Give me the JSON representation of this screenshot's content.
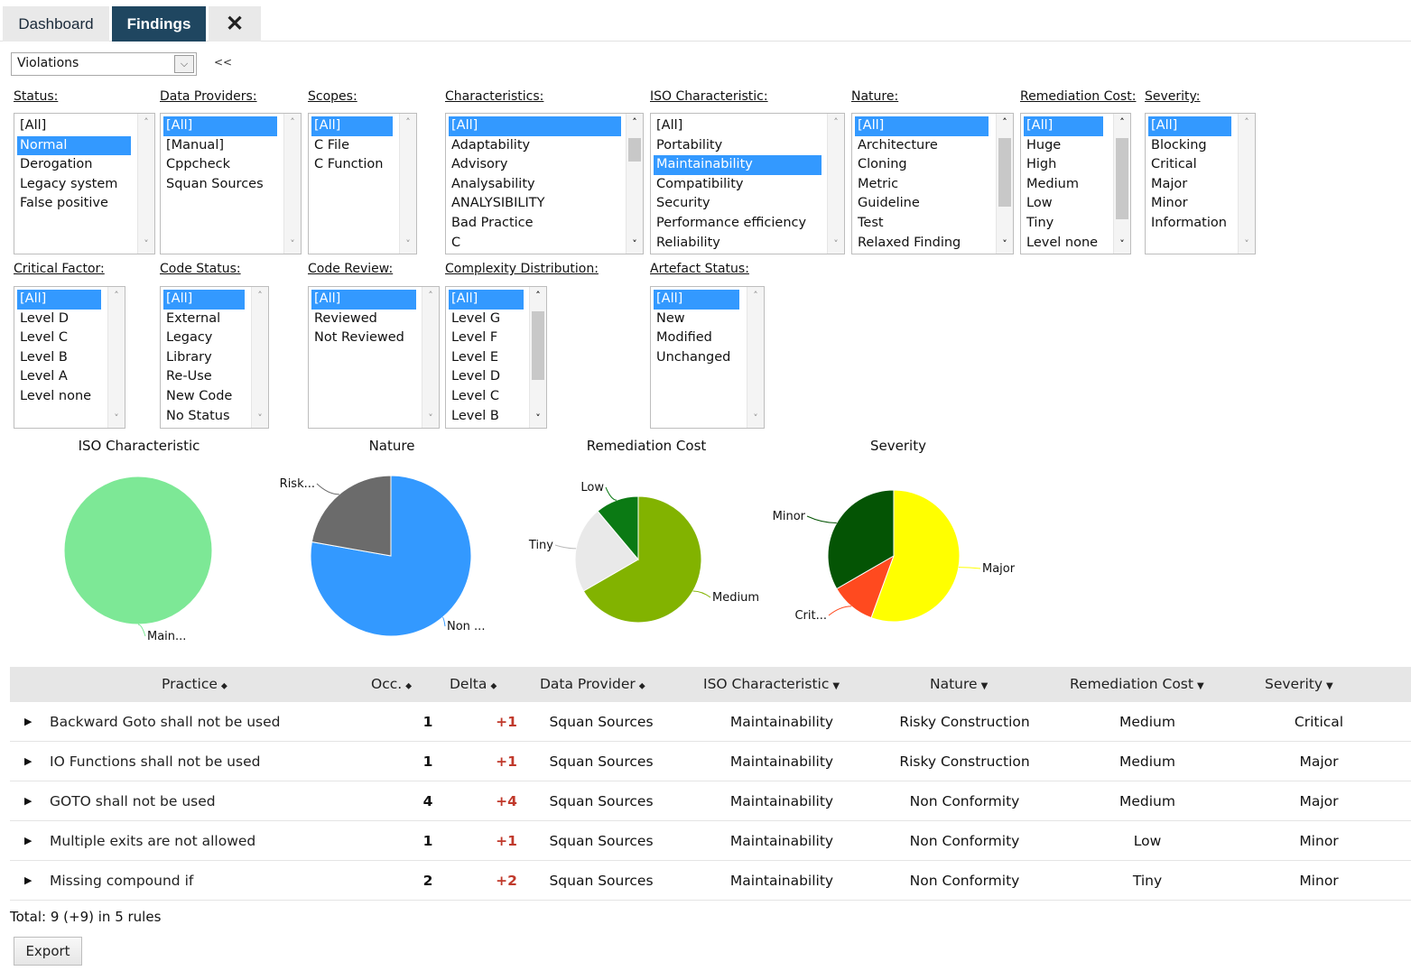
{
  "tabs": {
    "dashboard": "Dashboard",
    "findings": "Findings",
    "tools_icon": "tools-icon",
    "tools_glyph": "✕"
  },
  "view_select": {
    "value": "Violations",
    "collapse": "<<"
  },
  "filters": [
    {
      "label": "Status:",
      "options": [
        "[All]",
        "Normal",
        "Derogation",
        "Legacy system",
        "False positive"
      ],
      "selected": 1
    },
    {
      "label": "Data Providers:",
      "options": [
        "[All]",
        "[Manual]",
        "Cppcheck",
        "Squan Sources"
      ],
      "selected": 0
    },
    {
      "label": "Scopes:",
      "options": [
        "[All]",
        "C File",
        "C Function"
      ],
      "selected": 0
    },
    {
      "label": "Characteristics:",
      "options": [
        "[All]",
        "Adaptability",
        "Advisory",
        "Analysability",
        "ANALYSIBILITY",
        "Bad Practice",
        "C"
      ],
      "selected": 0
    },
    {
      "label": "ISO Characteristic:",
      "options": [
        "[All]",
        "Portability",
        "Maintainability",
        "Compatibility",
        "Security",
        "Performance efficiency",
        "Reliability"
      ],
      "selected": 2
    },
    {
      "label": "Nature:",
      "options": [
        "[All]",
        "Architecture",
        "Cloning",
        "Metric",
        "Guideline",
        "Test",
        "Relaxed Finding"
      ],
      "selected": 0
    },
    {
      "label": "Remediation Cost:",
      "options": [
        "[All]",
        "Huge",
        "High",
        "Medium",
        "Low",
        "Tiny",
        "Level none"
      ],
      "selected": 0
    },
    {
      "label": "Severity:",
      "options": [
        "[All]",
        "Blocking",
        "Critical",
        "Major",
        "Minor",
        "Information"
      ],
      "selected": 0
    },
    {
      "label": "Critical Factor:",
      "options": [
        "[All]",
        "Level D",
        "Level C",
        "Level B",
        "Level A",
        "Level none"
      ],
      "selected": 0
    },
    {
      "label": "Code Status:",
      "options": [
        "[All]",
        "External",
        "Legacy",
        "Library",
        "Re-Use",
        "New Code",
        "No Status"
      ],
      "selected": 0
    },
    {
      "label": "Code Review:",
      "options": [
        "[All]",
        "Reviewed",
        "Not Reviewed"
      ],
      "selected": 0
    },
    {
      "label": "Complexity Distribution:",
      "options": [
        "[All]",
        "Level G",
        "Level F",
        "Level E",
        "Level D",
        "Level C",
        "Level B"
      ],
      "selected": 0
    },
    {
      "label": "Artefact Status:",
      "options": [
        "[All]",
        "New",
        "Modified",
        "Unchanged"
      ],
      "selected": 0
    }
  ],
  "chart_data": [
    {
      "type": "pie",
      "title": "ISO Characteristic",
      "slices": [
        {
          "label": "Main...",
          "value": 9,
          "color": "#7de896"
        }
      ]
    },
    {
      "type": "pie",
      "title": "Nature",
      "slices": [
        {
          "label": "Non ...",
          "value": 7,
          "color": "#3399ff"
        },
        {
          "label": "Risk...",
          "value": 2,
          "color": "#6b6b6b"
        }
      ]
    },
    {
      "type": "pie",
      "title": "Remediation Cost",
      "slices": [
        {
          "label": "Medium",
          "value": 6,
          "color": "#82b300"
        },
        {
          "label": "Tiny",
          "value": 2,
          "color": "#e9e9e9"
        },
        {
          "label": "Low",
          "value": 1,
          "color": "#0b7a14"
        }
      ]
    },
    {
      "type": "pie",
      "title": "Severity",
      "slices": [
        {
          "label": "Major",
          "value": 5,
          "color": "#ffff00"
        },
        {
          "label": "Crit...",
          "value": 1,
          "color": "#ff4a1f"
        },
        {
          "label": "Minor",
          "value": 3,
          "color": "#045404"
        }
      ]
    }
  ],
  "table": {
    "headers": {
      "practice": "Practice",
      "occ": "Occ.",
      "delta": "Delta",
      "dp": "Data Provider",
      "iso": "ISO Characteristic",
      "nat": "Nature",
      "rc": "Remediation Cost",
      "sev": "Severity"
    },
    "sort_asc_glyph": "⬥",
    "sort_desc_glyph": "▼",
    "expander_glyph": "▶",
    "rows": [
      {
        "practice": "Backward Goto shall not be used",
        "occ": "1",
        "delta": "+1",
        "dp": "Squan Sources",
        "iso": "Maintainability",
        "nat": "Risky Construction",
        "rc": "Medium",
        "sev": "Critical"
      },
      {
        "practice": "IO Functions shall not be used",
        "occ": "1",
        "delta": "+1",
        "dp": "Squan Sources",
        "iso": "Maintainability",
        "nat": "Risky Construction",
        "rc": "Medium",
        "sev": "Major"
      },
      {
        "practice": "GOTO shall not be used",
        "occ": "4",
        "delta": "+4",
        "dp": "Squan Sources",
        "iso": "Maintainability",
        "nat": "Non Conformity",
        "rc": "Medium",
        "sev": "Major"
      },
      {
        "practice": "Multiple exits are not allowed",
        "occ": "1",
        "delta": "+1",
        "dp": "Squan Sources",
        "iso": "Maintainability",
        "nat": "Non Conformity",
        "rc": "Low",
        "sev": "Minor"
      },
      {
        "practice": "Missing compound if",
        "occ": "2",
        "delta": "+2",
        "dp": "Squan Sources",
        "iso": "Maintainability",
        "nat": "Non Conformity",
        "rc": "Tiny",
        "sev": "Minor"
      }
    ]
  },
  "footer": {
    "total": "Total: 9 (+9) in 5 rules",
    "export": "Export"
  }
}
